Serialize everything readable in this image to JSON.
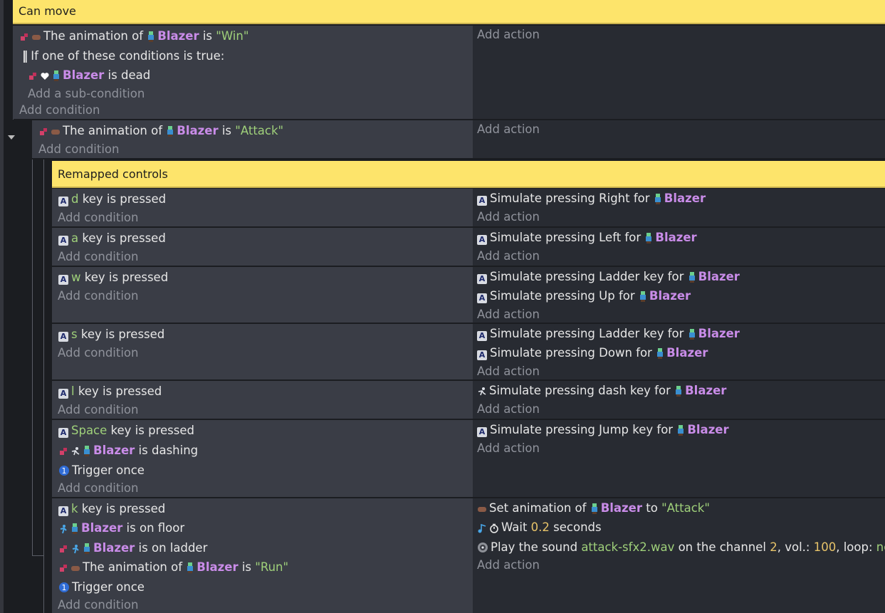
{
  "comments": {
    "can_move": "Can move",
    "remapped": "Remapped controls"
  },
  "add_condition": "Add condition",
  "add_action": "Add action",
  "add_sub_condition": "Add a sub-condition",
  "object_name": "Blazer",
  "event1": {
    "anim_prefix": "The animation of ",
    "is": " is ",
    "anim_value": "\"Win\"",
    "or_label": "If one of these conditions is true:",
    "dead_suffix": " is dead"
  },
  "event2": {
    "anim_prefix": "The animation of ",
    "is": " is ",
    "anim_value": "\"Attack\""
  },
  "key_suffix": " key is pressed",
  "key_icon": "A",
  "events": {
    "d": {
      "key": "d",
      "actions": [
        {
          "prefix": "Simulate pressing Right for "
        }
      ]
    },
    "a": {
      "key": "a",
      "actions": [
        {
          "prefix": "Simulate pressing Left for "
        }
      ]
    },
    "w": {
      "key": "w",
      "actions": [
        {
          "prefix": "Simulate pressing Ladder key for "
        },
        {
          "prefix": "Simulate pressing Up for "
        }
      ]
    },
    "s": {
      "key": "s",
      "actions": [
        {
          "prefix": "Simulate pressing Ladder key for "
        },
        {
          "prefix": "Simulate pressing Down for "
        }
      ]
    },
    "l": {
      "key": "l",
      "actions": [
        {
          "prefix": "Simulate pressing dash key for "
        }
      ]
    },
    "space": {
      "key": "Space",
      "dashing_suffix": " is dashing",
      "trigger_once": "Trigger once",
      "actions": [
        {
          "prefix": "Simulate pressing Jump key for "
        }
      ]
    },
    "k": {
      "key": "k",
      "on_floor_suffix": " is on floor",
      "on_ladder_suffix": " is on ladder",
      "anim_prefix": "The animation of ",
      "is": " is ",
      "anim_value": "\"Run\"",
      "trigger_once": "Trigger once",
      "set_anim_prefix": "Set animation of ",
      "set_anim_to": " to ",
      "set_anim_value": "\"Attack\"",
      "wait_prefix": "Wait ",
      "wait_value": "0.2",
      "wait_suffix": " seconds",
      "play_prefix": "Play the sound ",
      "play_file": "attack-sfx2.wav",
      "play_channel_text": " on the channel ",
      "play_channel": "2",
      "play_vol_text": ", vol.: ",
      "play_vol": "100",
      "play_loop_text": ", loop: ",
      "play_loop": "no"
    }
  },
  "colors": {
    "comment_bg": "#fde46b",
    "object": "#c98ce8",
    "string": "#9fd07a",
    "number": "#e8c46a"
  }
}
